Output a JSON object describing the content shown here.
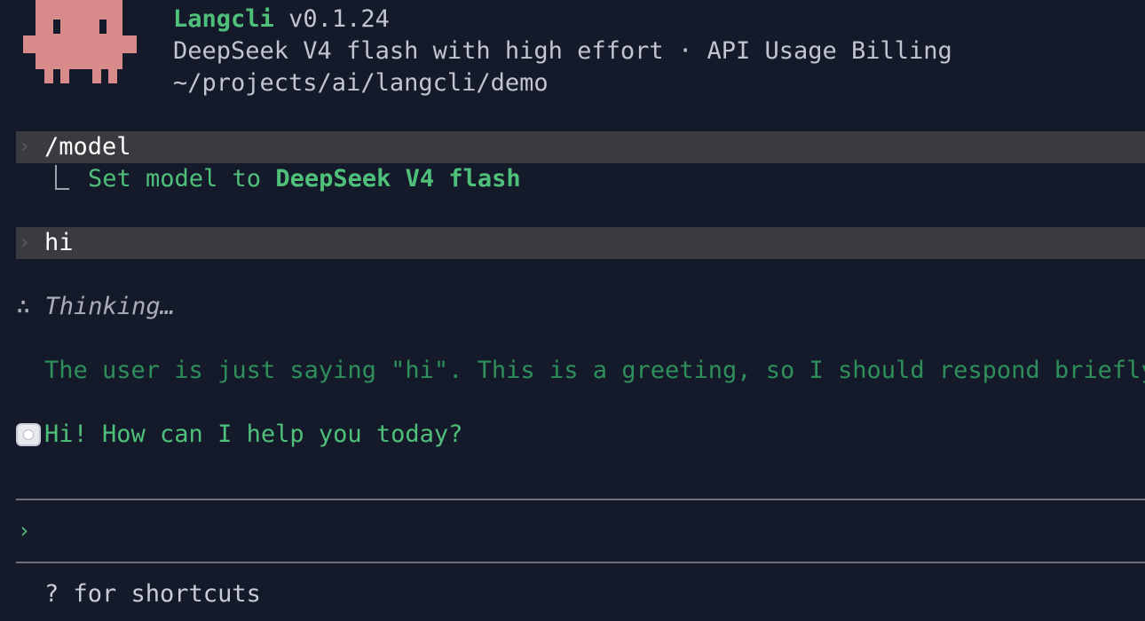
{
  "header": {
    "app_name": "Langcli",
    "version": "v0.1.24",
    "model_line": "DeepSeek V4 flash with high effort · API Usage Billing",
    "cwd": "~/projects/ai/langcli/demo"
  },
  "transcript": {
    "prompt_glyph": "›",
    "command": {
      "input": "/model",
      "result_prefix": "Set model to ",
      "result_value": "DeepSeek V4 flash"
    },
    "message": {
      "input": "hi",
      "thinking_glyph": "∴",
      "thinking_label": "Thinking…",
      "thinking_text": "The user is just saying \"hi\". This is a greeting, so I should respond briefly",
      "reply": "Hi! How can I help you today?"
    }
  },
  "input_box": {
    "prompt_glyph": "›",
    "value": ""
  },
  "footer": {
    "hint": "? for shortcuts"
  },
  "colors": {
    "background": "#151a2b",
    "accent_green": "#4fc07a",
    "mascot": "#d98a8a",
    "prompt_bar": "#3a3b3f"
  }
}
